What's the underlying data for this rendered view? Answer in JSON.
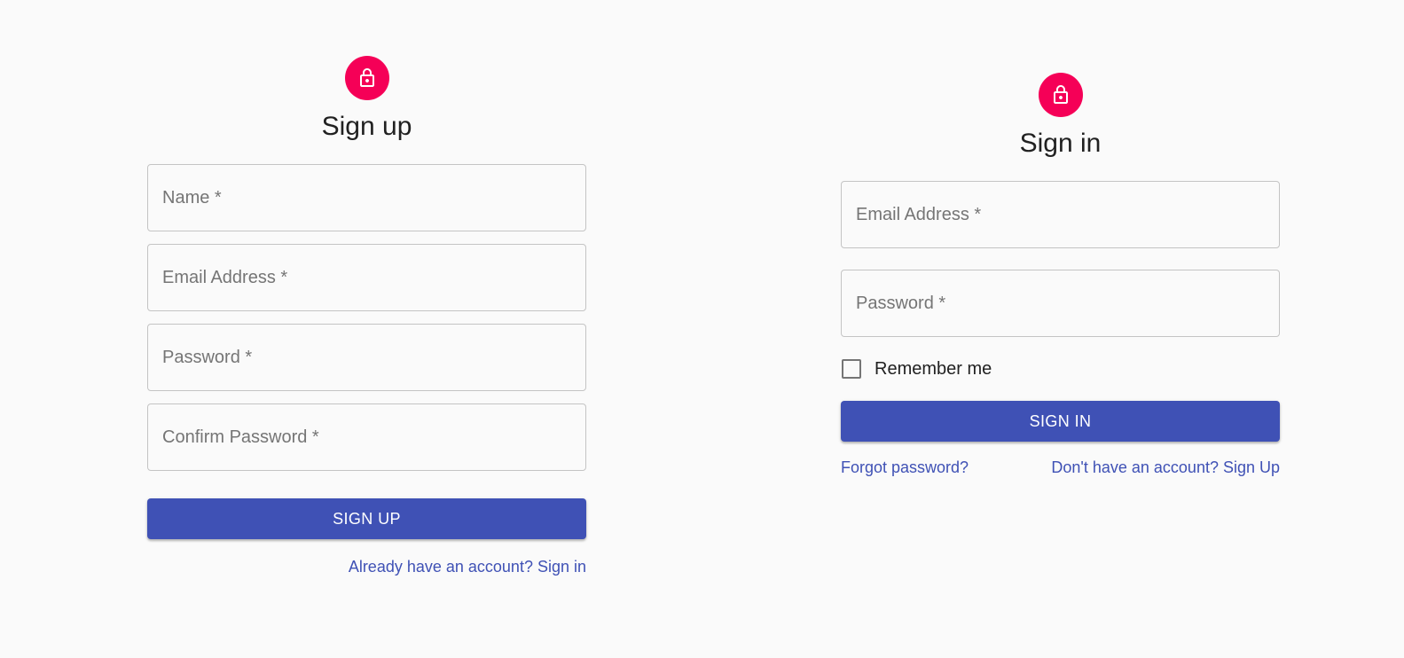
{
  "colors": {
    "background": "#fafafa",
    "avatar": "#f50057",
    "primary": "#3f51b5",
    "border": "#c4c4c4",
    "placeholder": "#757575",
    "text": "#212121"
  },
  "signup": {
    "icon": "lock-icon",
    "title": "Sign up",
    "fields": [
      {
        "placeholder": "Name *",
        "value": ""
      },
      {
        "placeholder": "Email Address *",
        "value": ""
      },
      {
        "placeholder": "Password *",
        "value": ""
      },
      {
        "placeholder": "Confirm Password *",
        "value": ""
      }
    ],
    "button_label": "Sign Up",
    "signin_link": "Already have an account? Sign in"
  },
  "signin": {
    "icon": "lock-icon",
    "title": "Sign in",
    "fields": [
      {
        "placeholder": "Email Address *",
        "value": ""
      },
      {
        "placeholder": "Password *",
        "value": ""
      }
    ],
    "remember_label": "Remember me",
    "remember_checked": false,
    "button_label": "Sign In",
    "forgot_link": "Forgot password?",
    "signup_link": "Don't have an account? Sign Up"
  }
}
